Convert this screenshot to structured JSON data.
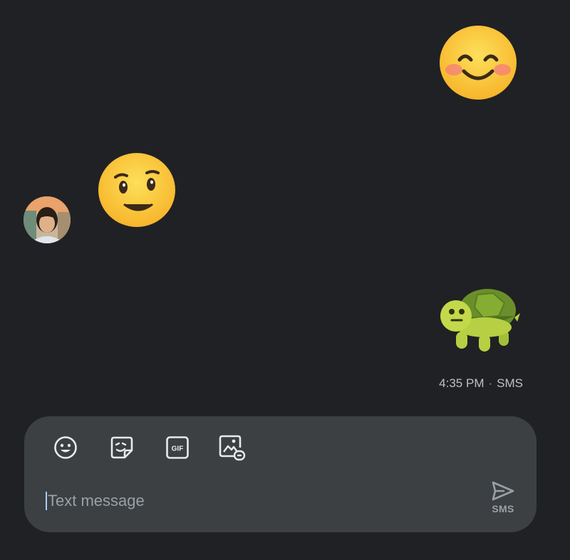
{
  "conversation": {
    "messages": [
      {
        "emoji": "smiling-face-with-smiling-eyes",
        "direction": "outgoing"
      },
      {
        "emoji": "woozy-face",
        "direction": "incoming"
      },
      {
        "emoji": "turtle",
        "direction": "outgoing"
      }
    ],
    "last_message_meta": {
      "time": "4:35 PM",
      "separator": "·",
      "type": "SMS"
    },
    "contact_avatar": "contact-photo"
  },
  "compose": {
    "placeholder": "Text message",
    "value": "",
    "send_label": "SMS",
    "tools": [
      "emoji-icon",
      "sticker-icon",
      "gif-icon",
      "attach-media-icon"
    ]
  },
  "colors": {
    "background": "#202124",
    "compose_bg": "#3c4043",
    "icon": "#e8eaed",
    "muted_text": "#9aa0a6",
    "caret": "#aecbfa"
  }
}
